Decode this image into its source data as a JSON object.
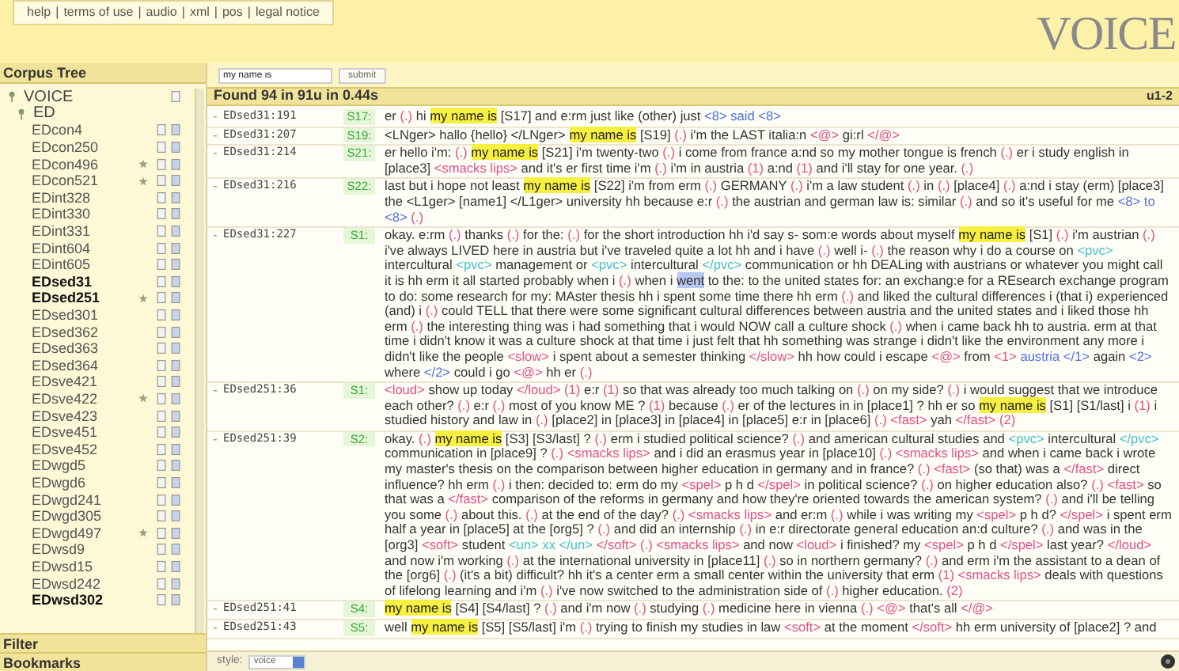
{
  "nav": {
    "links": [
      "help",
      "terms of use",
      "audio",
      "xml",
      "pos",
      "legal notice"
    ],
    "separator": "|"
  },
  "logo": "VOICE",
  "sidebar": {
    "title": "Corpus Tree",
    "tree": [
      {
        "label": "VOICE",
        "expanded": true,
        "children": [
          {
            "label": "ED",
            "expanded": true,
            "children": [
              {
                "label": "EDcon4",
                "has_matches": false,
                "marked": false
              },
              {
                "label": "EDcon250",
                "has_matches": false,
                "marked": false
              },
              {
                "label": "EDcon496",
                "has_matches": false,
                "marked": true
              },
              {
                "label": "EDcon521",
                "has_matches": false,
                "marked": true
              },
              {
                "label": "EDint328",
                "has_matches": false,
                "marked": false
              },
              {
                "label": "EDint330",
                "has_matches": false,
                "marked": false
              },
              {
                "label": "EDint331",
                "has_matches": false,
                "marked": false
              },
              {
                "label": "EDint604",
                "has_matches": false,
                "marked": false
              },
              {
                "label": "EDint605",
                "has_matches": false,
                "marked": false
              },
              {
                "label": "EDsed31",
                "has_matches": true,
                "marked": false
              },
              {
                "label": "EDsed251",
                "has_matches": true,
                "marked": true
              },
              {
                "label": "EDsed301",
                "has_matches": false,
                "marked": false
              },
              {
                "label": "EDsed362",
                "has_matches": false,
                "marked": false
              },
              {
                "label": "EDsed363",
                "has_matches": false,
                "marked": false
              },
              {
                "label": "EDsed364",
                "has_matches": false,
                "marked": false
              },
              {
                "label": "EDsve421",
                "has_matches": false,
                "marked": false
              },
              {
                "label": "EDsve422",
                "has_matches": false,
                "marked": true
              },
              {
                "label": "EDsve423",
                "has_matches": false,
                "marked": false
              },
              {
                "label": "EDsve451",
                "has_matches": false,
                "marked": false
              },
              {
                "label": "EDsve452",
                "has_matches": false,
                "marked": false
              },
              {
                "label": "EDwgd5",
                "has_matches": false,
                "marked": false
              },
              {
                "label": "EDwgd6",
                "has_matches": false,
                "marked": false
              },
              {
                "label": "EDwgd241",
                "has_matches": false,
                "marked": false
              },
              {
                "label": "EDwgd305",
                "has_matches": false,
                "marked": false
              },
              {
                "label": "EDwgd497",
                "has_matches": false,
                "marked": true
              },
              {
                "label": "EDwsd9",
                "has_matches": false,
                "marked": false
              },
              {
                "label": "EDwsd15",
                "has_matches": false,
                "marked": false
              },
              {
                "label": "EDwsd242",
                "has_matches": false,
                "marked": false
              },
              {
                "label": "EDwsd302",
                "has_matches": true,
                "marked": false
              }
            ]
          }
        ]
      }
    ],
    "panels": [
      "Filter",
      "Bookmarks"
    ]
  },
  "search": {
    "value": "my name is",
    "button": "submit"
  },
  "results": {
    "summary": "Found 94 in 91u in 0.44s",
    "range": "u1-2",
    "rows": [
      {
        "toggle": "-",
        "id": "EDsed31:191",
        "speaker": "S17:",
        "parts": [
          {
            "kind": "text",
            "text": "er"
          },
          {
            "kind": "pause",
            "text": "(.)"
          },
          {
            "kind": "text",
            "text": "hi"
          },
          {
            "kind": "hit",
            "text": "my name is"
          },
          {
            "kind": "text",
            "text": "[S17] and e:rm just like (other) just"
          },
          {
            "kind": "overlap",
            "text": "<8> said <8>"
          }
        ]
      },
      {
        "toggle": "-",
        "id": "EDsed31:207",
        "speaker": "S19:",
        "parts": [
          {
            "kind": "text",
            "text": "<LNger> hallo {hello} </LNger>"
          },
          {
            "kind": "hit",
            "text": "my name is"
          },
          {
            "kind": "text",
            "text": "[S19]"
          },
          {
            "kind": "pause",
            "text": "(.)"
          },
          {
            "kind": "text",
            "text": "i'm the LAST italia:n"
          },
          {
            "kind": "tag",
            "text": "<@>"
          },
          {
            "kind": "text",
            "text": "gi:rl"
          },
          {
            "kind": "tag",
            "text": "</@>"
          }
        ]
      },
      {
        "toggle": "-",
        "id": "EDsed31:214",
        "speaker": "S21:",
        "parts": [
          {
            "kind": "text",
            "text": "er hello i'm:"
          },
          {
            "kind": "pause",
            "text": "(.)"
          },
          {
            "kind": "hit",
            "text": "my name is"
          },
          {
            "kind": "text",
            "text": "[S21] i'm twenty-two"
          },
          {
            "kind": "pause",
            "text": "(.)"
          },
          {
            "kind": "text",
            "text": "i come from france a:nd so my mother tongue is french"
          },
          {
            "kind": "pause",
            "text": "(.)"
          },
          {
            "kind": "text",
            "text": "er i study english in [place3]"
          },
          {
            "kind": "tag",
            "text": "<smacks lips>"
          },
          {
            "kind": "text",
            "text": "and it's er first time i'm"
          },
          {
            "kind": "pause",
            "text": "(.)"
          },
          {
            "kind": "text",
            "text": "i'm in austria"
          },
          {
            "kind": "pause",
            "text": "(1)"
          },
          {
            "kind": "text",
            "text": "a:nd"
          },
          {
            "kind": "pause",
            "text": "(1)"
          },
          {
            "kind": "text",
            "text": "and i'll stay for one year."
          },
          {
            "kind": "pause",
            "text": "(.)"
          }
        ]
      },
      {
        "toggle": "-",
        "id": "EDsed31:216",
        "speaker": "S22:",
        "parts": [
          {
            "kind": "text",
            "text": "last but i hope not least"
          },
          {
            "kind": "hit",
            "text": "my name is"
          },
          {
            "kind": "text",
            "text": "[S22] i'm from erm"
          },
          {
            "kind": "pause",
            "text": "(.)"
          },
          {
            "kind": "text",
            "text": "GERMANY"
          },
          {
            "kind": "pause",
            "text": "(.)"
          },
          {
            "kind": "text",
            "text": "i'm a law student"
          },
          {
            "kind": "pause",
            "text": "(.)"
          },
          {
            "kind": "text",
            "text": "in"
          },
          {
            "kind": "pause",
            "text": "(.)"
          },
          {
            "kind": "text",
            "text": "[place4]"
          },
          {
            "kind": "pause",
            "text": "(.)"
          },
          {
            "kind": "text",
            "text": "a:nd i stay (erm) [place3] the <L1ger> [name1] </L1ger> university hh because e:r"
          },
          {
            "kind": "pause",
            "text": "(.)"
          },
          {
            "kind": "text",
            "text": "the austrian and german law is: similar"
          },
          {
            "kind": "pause",
            "text": "(.)"
          },
          {
            "kind": "text",
            "text": "and so it's useful for me"
          },
          {
            "kind": "overlap",
            "text": "<8> to <8>"
          },
          {
            "kind": "pause",
            "text": "(.)"
          }
        ]
      },
      {
        "toggle": "-",
        "id": "EDsed31:227",
        "speaker": "S1:",
        "parts": [
          {
            "kind": "text",
            "text": "okay. e:rm"
          },
          {
            "kind": "pause",
            "text": "(.)"
          },
          {
            "kind": "text",
            "text": "thanks"
          },
          {
            "kind": "pause",
            "text": "(.)"
          },
          {
            "kind": "text",
            "text": "for the:"
          },
          {
            "kind": "pause",
            "text": "(.)"
          },
          {
            "kind": "text",
            "text": "for the short introduction hh i'd say s- som:e words about myself"
          },
          {
            "kind": "hit",
            "text": "my name is"
          },
          {
            "kind": "text",
            "text": "[S1]"
          },
          {
            "kind": "pause",
            "text": "(.)"
          },
          {
            "kind": "text",
            "text": "i'm austrian"
          },
          {
            "kind": "pause",
            "text": "(.)"
          },
          {
            "kind": "text",
            "text": "i've always LIVED here in austria but i've traveled quite a lot hh and i have"
          },
          {
            "kind": "pause",
            "text": "(.)"
          },
          {
            "kind": "text",
            "text": "well i-"
          },
          {
            "kind": "pause",
            "text": "(.)"
          },
          {
            "kind": "text",
            "text": "the reason why i do a course on"
          },
          {
            "kind": "pvc",
            "text": "<pvc>"
          },
          {
            "kind": "text",
            "text": "intercultural"
          },
          {
            "kind": "pvc",
            "text": "<pvc>"
          },
          {
            "kind": "text",
            "text": "management or"
          },
          {
            "kind": "pvc",
            "text": "<pvc>"
          },
          {
            "kind": "text",
            "text": "intercultural"
          },
          {
            "kind": "pvc",
            "text": "</pvc>"
          },
          {
            "kind": "text",
            "text": "communication or hh DEALing with austrians or whatever you might call it is hh erm it all started probably when i"
          },
          {
            "kind": "pause",
            "text": "(.)"
          },
          {
            "kind": "text",
            "text": "when i"
          },
          {
            "kind": "select",
            "text": "went"
          },
          {
            "kind": "text",
            "text": "to the: to the united states for: an exchang:e for a REsearch exchange program to do: some research for my: MAster thesis hh i spent some time there hh erm"
          },
          {
            "kind": "pause",
            "text": "(.)"
          },
          {
            "kind": "text",
            "text": "and liked the cultural differences i (that i) experienced (and) i"
          },
          {
            "kind": "pause",
            "text": "(.)"
          },
          {
            "kind": "text",
            "text": "could TELL that there were some significant cultural differences between austria and the united states and i liked those hh erm"
          },
          {
            "kind": "pause",
            "text": "(.)"
          },
          {
            "kind": "text",
            "text": "the interesting thing was i had something that i would NOW call a culture shock"
          },
          {
            "kind": "pause",
            "text": "(.)"
          },
          {
            "kind": "text",
            "text": "when i came back hh to austria. erm at that time i didn't know it was a culture shock at that time i just felt that hh something was strange i didn't like the environment any more i didn't like the people"
          },
          {
            "kind": "tag",
            "text": "<slow>"
          },
          {
            "kind": "text",
            "text": "i spent about a semester thinking"
          },
          {
            "kind": "tag",
            "text": "</slow>"
          },
          {
            "kind": "text",
            "text": "hh how could i escape"
          },
          {
            "kind": "tag",
            "text": "<@>"
          },
          {
            "kind": "text",
            "text": "from"
          },
          {
            "kind": "tag",
            "text": "<1>"
          },
          {
            "kind": "overlap",
            "text": "austria </1>"
          },
          {
            "kind": "text",
            "text": "again"
          },
          {
            "kind": "overlap",
            "text": "<2>"
          },
          {
            "kind": "text",
            "text": "where"
          },
          {
            "kind": "overlap",
            "text": "</2>"
          },
          {
            "kind": "text",
            "text": "could i go"
          },
          {
            "kind": "tag",
            "text": "<@>"
          },
          {
            "kind": "text",
            "text": "hh er"
          },
          {
            "kind": "pause",
            "text": "(.)"
          }
        ]
      },
      {
        "toggle": "-",
        "id": "EDsed251:36",
        "speaker": "S1:",
        "parts": [
          {
            "kind": "tag",
            "text": "<loud>"
          },
          {
            "kind": "text",
            "text": "show up today"
          },
          {
            "kind": "tag",
            "text": "</loud>"
          },
          {
            "kind": "pause",
            "text": "(1)"
          },
          {
            "kind": "text",
            "text": "e:r"
          },
          {
            "kind": "pause",
            "text": "(1)"
          },
          {
            "kind": "text",
            "text": "so that was already too much talking on"
          },
          {
            "kind": "pause",
            "text": "(.)"
          },
          {
            "kind": "text",
            "text": "on my side?"
          },
          {
            "kind": "pause",
            "text": "(.)"
          },
          {
            "kind": "text",
            "text": "i would suggest that we introduce each other?"
          },
          {
            "kind": "pause",
            "text": "(.)"
          },
          {
            "kind": "text",
            "text": "e:r"
          },
          {
            "kind": "pause",
            "text": "(.)"
          },
          {
            "kind": "text",
            "text": "most of you know ME ?"
          },
          {
            "kind": "pause",
            "text": "(1)"
          },
          {
            "kind": "text",
            "text": "because"
          },
          {
            "kind": "pause",
            "text": "(.)"
          },
          {
            "kind": "text",
            "text": "er of the lectures in in [place1] ? hh er so"
          },
          {
            "kind": "hit",
            "text": "my name is"
          },
          {
            "kind": "text",
            "text": "[S1] [S1/last] i"
          },
          {
            "kind": "pause",
            "text": "(1)"
          },
          {
            "kind": "text",
            "text": "i studied history and law in"
          },
          {
            "kind": "pause",
            "text": "(.)"
          },
          {
            "kind": "text",
            "text": "[place2] in [place3] in [place4] in [place5] e:r in [place6]"
          },
          {
            "kind": "pause",
            "text": "(.)"
          },
          {
            "kind": "tag",
            "text": "<fast>"
          },
          {
            "kind": "text",
            "text": "yah"
          },
          {
            "kind": "tag",
            "text": "</fast>"
          },
          {
            "kind": "pause",
            "text": "(2)"
          }
        ]
      },
      {
        "toggle": "-",
        "id": "EDsed251:39",
        "speaker": "S2:",
        "parts": [
          {
            "kind": "text",
            "text": "okay."
          },
          {
            "kind": "pause",
            "text": "(.)"
          },
          {
            "kind": "hit",
            "text": "my name is"
          },
          {
            "kind": "text",
            "text": "[S3] [S3/last] ?"
          },
          {
            "kind": "pause",
            "text": "(.)"
          },
          {
            "kind": "text",
            "text": "erm i studied political science?"
          },
          {
            "kind": "pause",
            "text": "(.)"
          },
          {
            "kind": "text",
            "text": "and american cultural studies and"
          },
          {
            "kind": "pvc",
            "text": "<pvc>"
          },
          {
            "kind": "text",
            "text": "intercultural"
          },
          {
            "kind": "pvc",
            "text": "</pvc>"
          },
          {
            "kind": "text",
            "text": "communication in [place9] ?"
          },
          {
            "kind": "pause",
            "text": "(.)"
          },
          {
            "kind": "tag",
            "text": "<smacks lips>"
          },
          {
            "kind": "text",
            "text": "and i did an erasmus year in [place10]"
          },
          {
            "kind": "pause",
            "text": "(.)"
          },
          {
            "kind": "tag",
            "text": "<smacks lips>"
          },
          {
            "kind": "text",
            "text": "and when i came back i wrote my master's thesis on the comparison between higher education in germany and in france?"
          },
          {
            "kind": "pause",
            "text": "(.)"
          },
          {
            "kind": "tag",
            "text": "<fast>"
          },
          {
            "kind": "text",
            "text": "(so that) was a"
          },
          {
            "kind": "tag",
            "text": "</fast>"
          },
          {
            "kind": "text",
            "text": "direct influence? hh erm"
          },
          {
            "kind": "pause",
            "text": "(.)"
          },
          {
            "kind": "text",
            "text": "i then: decided to: erm do my"
          },
          {
            "kind": "tag",
            "text": "<spel>"
          },
          {
            "kind": "text",
            "text": "p h d"
          },
          {
            "kind": "tag",
            "text": "</spel>"
          },
          {
            "kind": "text",
            "text": "in political science?"
          },
          {
            "kind": "pause",
            "text": "(.)"
          },
          {
            "kind": "text",
            "text": "on higher education also?"
          },
          {
            "kind": "pause",
            "text": "(.)"
          },
          {
            "kind": "tag",
            "text": "<fast>"
          },
          {
            "kind": "text",
            "text": "so that was a"
          },
          {
            "kind": "tag",
            "text": "</fast>"
          },
          {
            "kind": "text",
            "text": "comparison of the reforms in germany and how they're oriented towards the american system?"
          },
          {
            "kind": "pause",
            "text": "(.)"
          },
          {
            "kind": "text",
            "text": "and i'll be telling you some"
          },
          {
            "kind": "pause",
            "text": "(.)"
          },
          {
            "kind": "text",
            "text": "about this."
          },
          {
            "kind": "pause",
            "text": "(.)"
          },
          {
            "kind": "text",
            "text": "at the end of the day?"
          },
          {
            "kind": "pause",
            "text": "(.)"
          },
          {
            "kind": "tag",
            "text": "<smacks lips>"
          },
          {
            "kind": "text",
            "text": "and er:m"
          },
          {
            "kind": "pause",
            "text": "(.)"
          },
          {
            "kind": "text",
            "text": "while i was writing my"
          },
          {
            "kind": "tag",
            "text": "<spel>"
          },
          {
            "kind": "text",
            "text": "p h d?"
          },
          {
            "kind": "tag",
            "text": "</spel>"
          },
          {
            "kind": "text",
            "text": "i spent erm half a year in [place5] at the [org5] ?"
          },
          {
            "kind": "pause",
            "text": "(.)"
          },
          {
            "kind": "text",
            "text": "and did an internship"
          },
          {
            "kind": "pause",
            "text": "(.)"
          },
          {
            "kind": "text",
            "text": "in e:r directorate general education an:d culture?"
          },
          {
            "kind": "pause",
            "text": "(.)"
          },
          {
            "kind": "text",
            "text": "and was in the [org3]"
          },
          {
            "kind": "tag",
            "text": "<soft>"
          },
          {
            "kind": "text",
            "text": "student"
          },
          {
            "kind": "pvc",
            "text": "<un> xx </un>"
          },
          {
            "kind": "tag",
            "text": "</soft>"
          },
          {
            "kind": "pause",
            "text": "(.)"
          },
          {
            "kind": "tag",
            "text": "<smacks lips>"
          },
          {
            "kind": "text",
            "text": "and now"
          },
          {
            "kind": "tag",
            "text": "<loud>"
          },
          {
            "kind": "text",
            "text": "i finished? my"
          },
          {
            "kind": "tag",
            "text": "<spel>"
          },
          {
            "kind": "text",
            "text": "p h d"
          },
          {
            "kind": "tag",
            "text": "</spel>"
          },
          {
            "kind": "text",
            "text": "last year?"
          },
          {
            "kind": "tag",
            "text": "</loud>"
          },
          {
            "kind": "text",
            "text": "and now i'm working"
          },
          {
            "kind": "pause",
            "text": "(.)"
          },
          {
            "kind": "text",
            "text": "at the international university in [place11]"
          },
          {
            "kind": "pause",
            "text": "(.)"
          },
          {
            "kind": "text",
            "text": "so in northern germany?"
          },
          {
            "kind": "pause",
            "text": "(.)"
          },
          {
            "kind": "text",
            "text": "and erm i'm the assistant to a dean of the [org6]"
          },
          {
            "kind": "pause",
            "text": "(.)"
          },
          {
            "kind": "text",
            "text": "(it's a bit) difficult? hh it's a center erm a small center within the university that erm"
          },
          {
            "kind": "pause",
            "text": "(1)"
          },
          {
            "kind": "tag",
            "text": "<smacks lips>"
          },
          {
            "kind": "text",
            "text": "deals with questions of lifelong learning and i'm"
          },
          {
            "kind": "pause",
            "text": "(.)"
          },
          {
            "kind": "text",
            "text": "i've now switched to the administration side of"
          },
          {
            "kind": "pause",
            "text": "(.)"
          },
          {
            "kind": "text",
            "text": "higher education."
          },
          {
            "kind": "pause",
            "text": "(2)"
          }
        ]
      },
      {
        "toggle": "-",
        "id": "EDsed251:41",
        "speaker": "S4:",
        "parts": [
          {
            "kind": "hit",
            "text": "my name is"
          },
          {
            "kind": "text",
            "text": "[S4] [S4/last] ?"
          },
          {
            "kind": "pause",
            "text": "(.)"
          },
          {
            "kind": "text",
            "text": "and i'm now"
          },
          {
            "kind": "pause",
            "text": "(.)"
          },
          {
            "kind": "text",
            "text": "studying"
          },
          {
            "kind": "pause",
            "text": "(.)"
          },
          {
            "kind": "text",
            "text": "medicine here in vienna"
          },
          {
            "kind": "pause",
            "text": "(.)"
          },
          {
            "kind": "tag",
            "text": "<@>"
          },
          {
            "kind": "text",
            "text": "that's all"
          },
          {
            "kind": "tag",
            "text": "</@>"
          }
        ]
      },
      {
        "toggle": "-",
        "id": "EDsed251:43",
        "speaker": "S5:",
        "parts": [
          {
            "kind": "text",
            "text": "well"
          },
          {
            "kind": "hit",
            "text": "my name is"
          },
          {
            "kind": "text",
            "text": "[S5] [S5/last] i'm"
          },
          {
            "kind": "pause",
            "text": "(.)"
          },
          {
            "kind": "text",
            "text": "trying to finish my studies in law"
          },
          {
            "kind": "tag",
            "text": "<soft>"
          },
          {
            "kind": "text",
            "text": "at the moment"
          },
          {
            "kind": "tag",
            "text": "</soft>"
          },
          {
            "kind": "text",
            "text": "hh erm university of [place2] ? and"
          }
        ]
      }
    ]
  },
  "footer": {
    "style_label": "style:",
    "style_value": "voice"
  }
}
